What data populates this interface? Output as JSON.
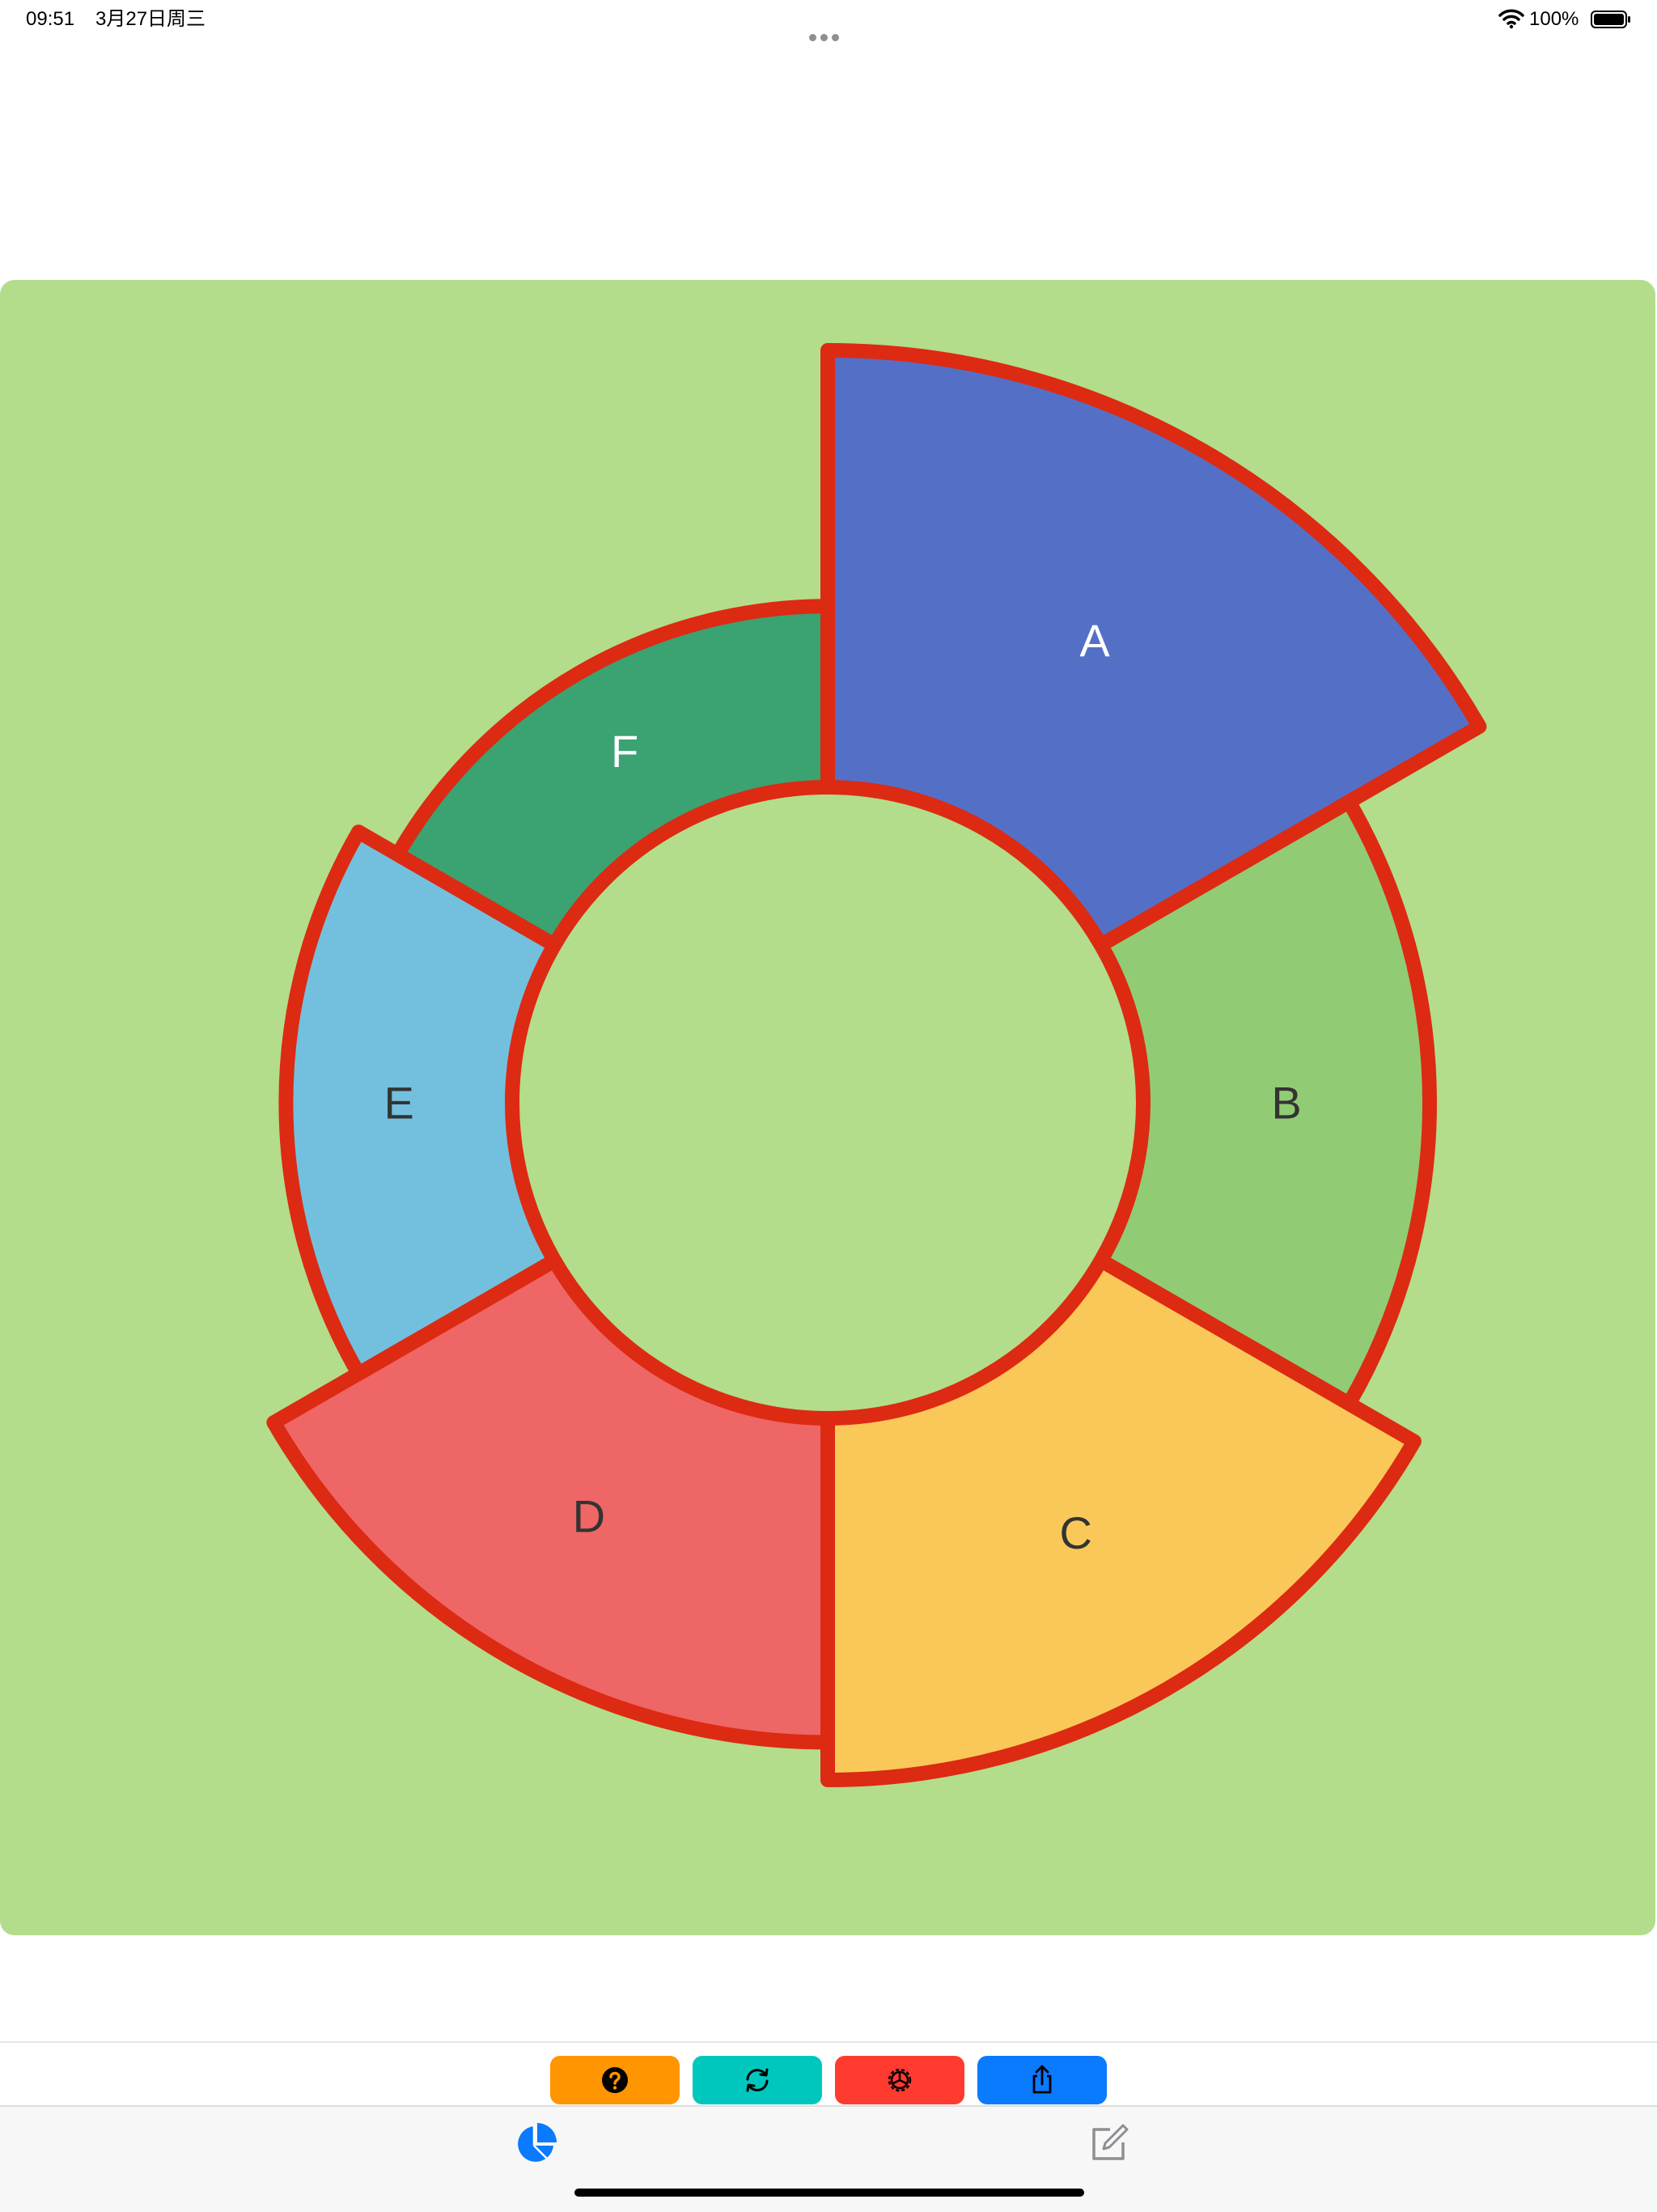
{
  "status_bar": {
    "time": "09:51",
    "date": "3月27日周三",
    "battery": "100%",
    "icons": [
      "more-dots-icon",
      "wifi-icon",
      "battery-icon"
    ]
  },
  "colors": {
    "panel_background": "#b3dd8a",
    "segment_border": "#dd2a12",
    "accent_blue": "#0a7aff"
  },
  "chart_data": {
    "type": "pie",
    "style": "donut",
    "categories": [
      "A",
      "B",
      "C",
      "D",
      "E",
      "F"
    ],
    "values": [
      1,
      1,
      1,
      1,
      1,
      1
    ],
    "colors": [
      "#5470c6",
      "#91cc75",
      "#fac858",
      "#ee6666",
      "#73c0de",
      "#3ba272"
    ],
    "label_colors": [
      "#ffffff",
      "#333333",
      "#333333",
      "#333333",
      "#333333",
      "#ffffff"
    ],
    "radius_scale": [
      1.0,
      0.8,
      0.9,
      0.85,
      0.72,
      0.66
    ],
    "border_color": "#dd2a12",
    "start_angle_deg": 90,
    "direction": "clockwise"
  },
  "toolbar": {
    "buttons": [
      {
        "name": "help-button",
        "icon": "question-icon",
        "color": "#ff9500"
      },
      {
        "name": "refresh-button",
        "icon": "refresh-icon",
        "color": "#00c7be"
      },
      {
        "name": "settings-button",
        "icon": "gear-icon",
        "color": "#ff3b30"
      },
      {
        "name": "share-button",
        "icon": "share-icon",
        "color": "#0a7aff"
      }
    ]
  },
  "tab_bar": {
    "tabs": [
      {
        "name": "tab-chart",
        "icon": "pie-chart-icon",
        "selected": true
      },
      {
        "name": "tab-edit",
        "icon": "edit-icon",
        "selected": false
      }
    ]
  }
}
